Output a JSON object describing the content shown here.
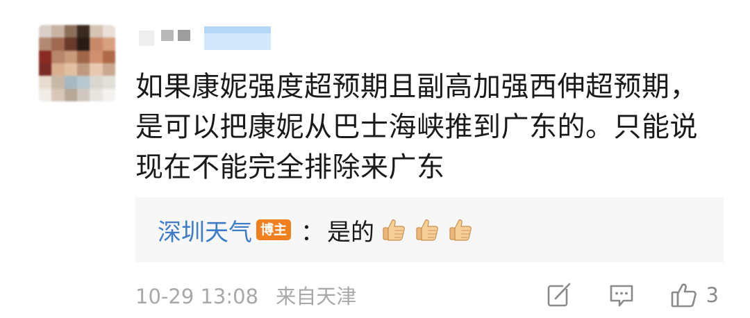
{
  "comment": {
    "lines": [
      "如果康妮强度超预期且副高加强西伸超预期，",
      "是可以把康妮从巴士海峡推到广东的。只能说",
      "现在不能完全排除来广东"
    ]
  },
  "reply": {
    "author": "深圳天气",
    "badge": "博主",
    "colon": "：",
    "text": "是的",
    "thumbs_icon": "thumbs-up-emoji",
    "thumbs_count": 3,
    "author_color": "#3d7cc6",
    "badge_color": "#f07f1f"
  },
  "footer": {
    "time": "10-29 13:08",
    "source": "来自天津",
    "share_icon": "share-icon",
    "comment_icon": "comment-icon",
    "like_icon": "like-icon",
    "like_count": "3"
  },
  "avatar": {
    "icon": "avatar-pixelated"
  }
}
